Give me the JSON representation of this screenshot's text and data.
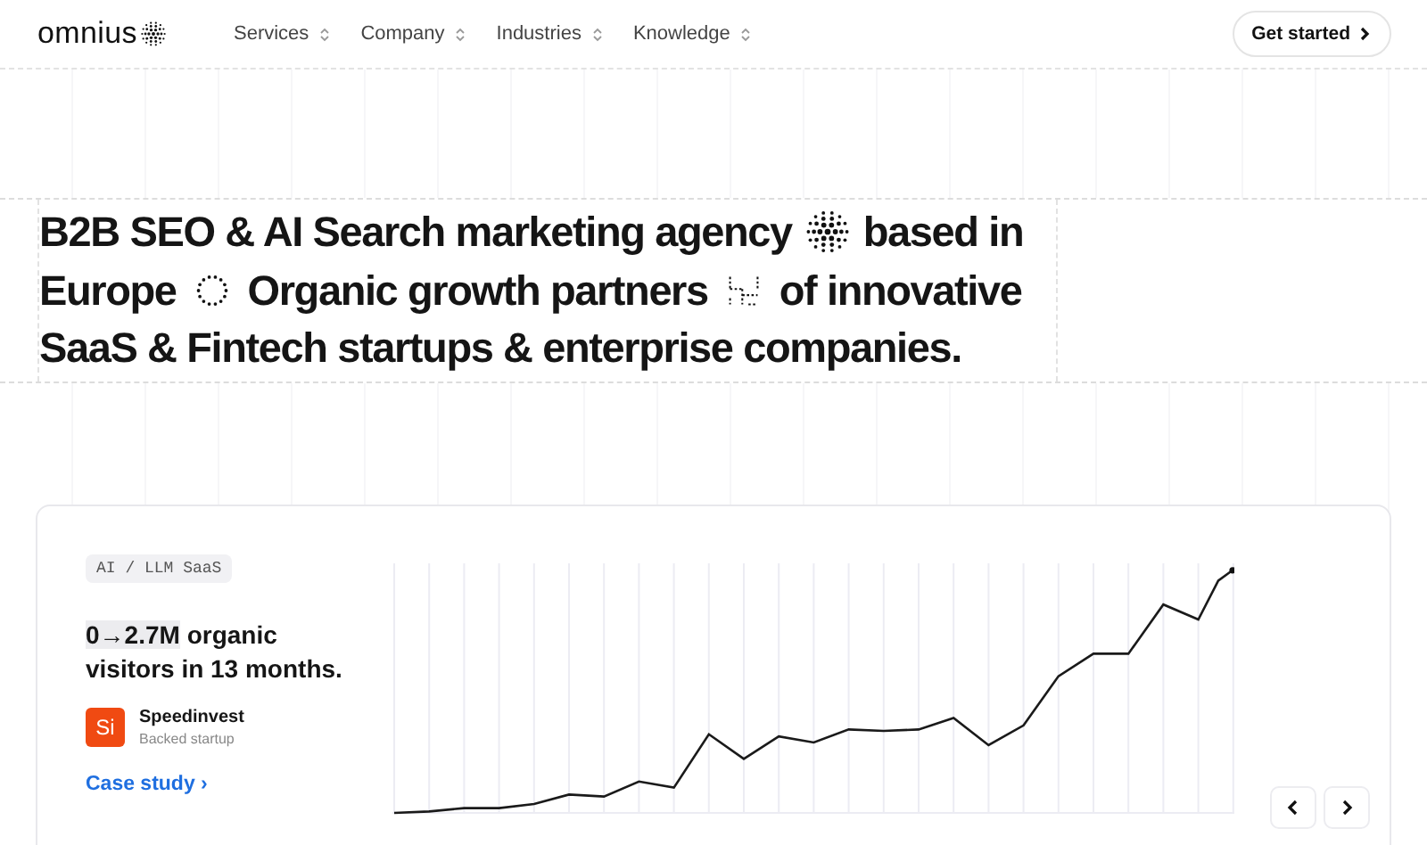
{
  "nav": {
    "logo": "omnius",
    "links": [
      {
        "label": "Services"
      },
      {
        "label": "Company"
      },
      {
        "label": "Industries"
      },
      {
        "label": "Knowledge"
      }
    ],
    "cta": "Get started"
  },
  "headline": [
    "B2B SEO & AI Search marketing agency",
    "based in",
    "Europe",
    "Organic growth partners",
    "of innovative",
    "SaaS & Fintech startups & enterprise companies."
  ],
  "case": {
    "tag": "AI / LLM SaaS",
    "highlight": "0→2.7M",
    "metric": "organic visitors in 13 months.",
    "company": {
      "initials": "Si",
      "name": "Speedinvest",
      "note": "Backed startup"
    },
    "link": "Case study ›"
  }
}
